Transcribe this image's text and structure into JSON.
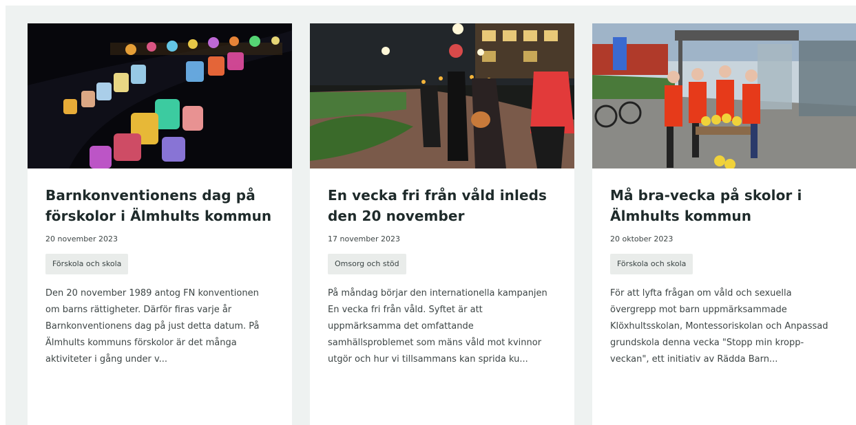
{
  "cards": [
    {
      "title": "Barnkonventionens dag på förskolor i Älmhults kommun",
      "date": "20 november 2023",
      "tag": "Förskola och skola",
      "excerpt": "Den 20 november 1989 antog FN konventionen om barns rättigheter. Därför firas varje år Barnkonventionens dag på just detta datum. På Älmhults kommuns förskolor är det många aktiviteter i gång under v...",
      "image_alt": "paper-lanterns-photo"
    },
    {
      "title": "En vecka fri från våld inleds den 20 november",
      "date": "17 november 2023",
      "tag": "Omsorg och stöd",
      "excerpt": "På måndag börjar den internationella kampanjen En vecka fri från våld. Syftet är att uppmärksamma det omfattande samhällsproblemet som mäns våld mot kvinnor utgör och hur vi tillsammans kan sprida ku...",
      "image_alt": "torch-walk-photo"
    },
    {
      "title": "Må bra-vecka på skolor i Älmhults kommun",
      "date": "20 oktober 2023",
      "tag": "Förskola och skola",
      "excerpt": "För att lyfta frågan om våld och sexuella övergrepp mot barn uppmärksammade Klöxhultsskolan, Montessoriskolan och Anpassad grundskola denna vecka \"Stopp min kropp-veckan\", ett initiativ av Rädda Barn...",
      "image_alt": "people-in-vests-photo"
    }
  ]
}
